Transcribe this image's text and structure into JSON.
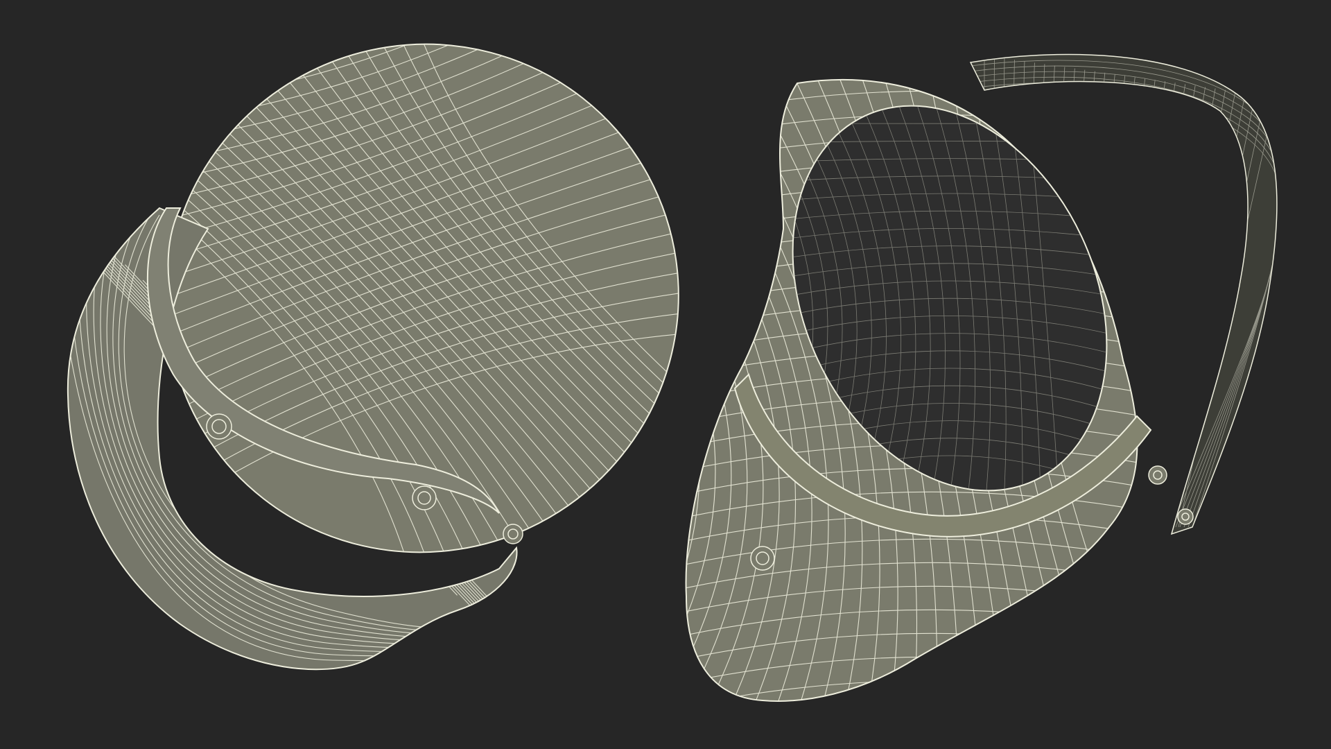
{
  "scene": {
    "background_color": "#262626",
    "mesh_fill_color": "#7a7b6c",
    "mesh_fill_dark_color": "#5e5f53",
    "wire_color": "#eeeedd",
    "interior_color": "#2e2e2e",
    "objects": [
      {
        "label": "helmet-exterior-top-view",
        "icon": "helmet-icon"
      },
      {
        "label": "helmet-interior-view",
        "icon": "helmet-icon"
      }
    ]
  }
}
